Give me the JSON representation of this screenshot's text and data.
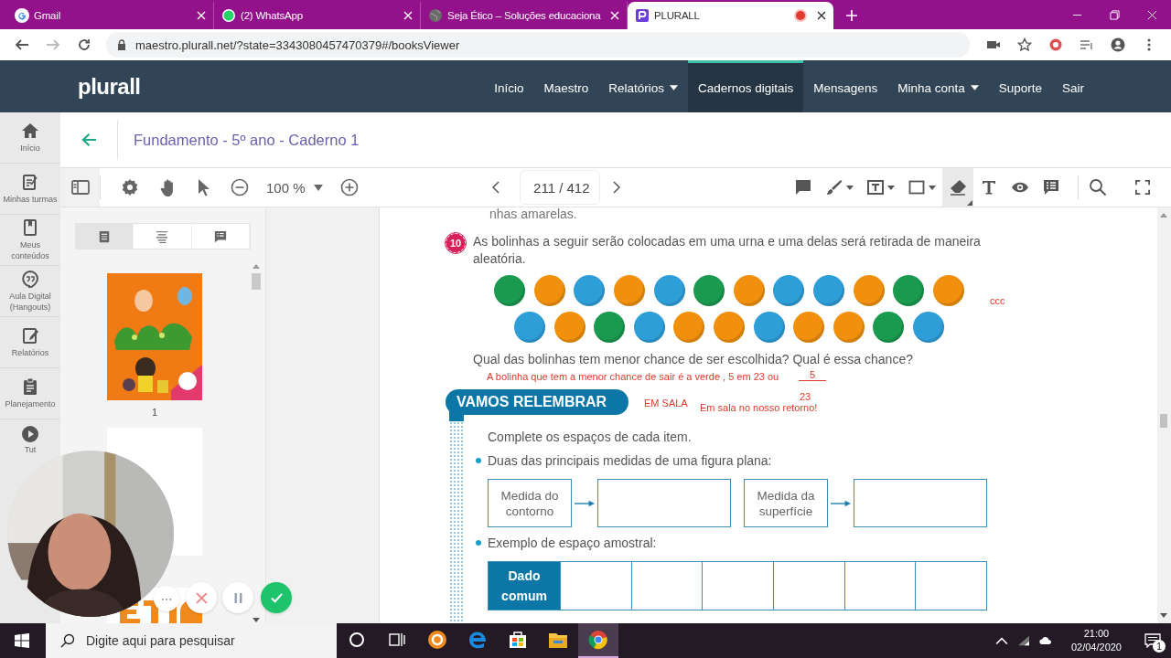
{
  "browser": {
    "tabs": [
      {
        "kind": "gmail",
        "title": "Gmail",
        "selected": false,
        "recording": false
      },
      {
        "kind": "whatsapp",
        "title": "(2) WhatsApp",
        "selected": false,
        "recording": false
      },
      {
        "kind": "web",
        "title": "Seja Ético – Soluções educaciona",
        "selected": false,
        "recording": false
      },
      {
        "kind": "plurall",
        "title": "PLURALL",
        "selected": true,
        "recording": true
      }
    ],
    "url": "maestro.plurall.net/?state=3343080457470379#/booksViewer"
  },
  "nav": {
    "logo": "plurall",
    "items": [
      {
        "label": "Início",
        "selected": false,
        "menu": false
      },
      {
        "label": "Maestro",
        "selected": false,
        "menu": false
      },
      {
        "label": "Relatórios",
        "selected": false,
        "menu": true
      },
      {
        "label": "Cadernos digitais",
        "selected": true,
        "menu": false
      },
      {
        "label": "Mensagens",
        "selected": false,
        "menu": false
      },
      {
        "label": "Minha conta",
        "selected": false,
        "menu": true
      },
      {
        "label": "Suporte",
        "selected": false,
        "menu": false
      },
      {
        "label": "Sair",
        "selected": false,
        "menu": false
      }
    ]
  },
  "rail": {
    "items": [
      {
        "kind": "home",
        "label": "Início"
      },
      {
        "kind": "edit",
        "label": "Minhas turmas"
      },
      {
        "kind": "book",
        "label": "Meus conteúdos"
      },
      {
        "kind": "chat",
        "label": "Aula Digital (Hangouts)"
      },
      {
        "kind": "report",
        "label": "Relatórios"
      },
      {
        "kind": "clipboard",
        "label": "Planejamento"
      },
      {
        "kind": "play",
        "label": "Tut"
      }
    ]
  },
  "header": {
    "title": "Fundamento - 5º ano - Caderno 1"
  },
  "toolbar": {
    "zoom": "100 %",
    "page": "211 / 412",
    "tools": [
      {
        "kind": "comment",
        "selected": false,
        "menu": false
      },
      {
        "kind": "pen",
        "selected": false,
        "menu": true
      },
      {
        "kind": "textbox",
        "selected": false,
        "menu": true
      },
      {
        "kind": "shape",
        "selected": false,
        "menu": true
      },
      {
        "kind": "eraser",
        "selected": true,
        "menu": false
      },
      {
        "kind": "text",
        "selected": false,
        "menu": false
      },
      {
        "kind": "eye",
        "selected": false,
        "menu": false
      },
      {
        "kind": "notes",
        "selected": false,
        "menu": false
      }
    ]
  },
  "sidebar": {
    "tabs": [
      {
        "kind": "thumbnails",
        "selected": true
      },
      {
        "kind": "outline",
        "selected": false
      },
      {
        "kind": "annotations",
        "selected": false
      }
    ],
    "page_label": "1"
  },
  "page": {
    "cut_line": "nhas amarelas.",
    "question": {
      "number": "10",
      "text": "As bolinhas a seguir serão colocadas em uma urna e uma delas será retirada de maneira aleatória.",
      "balls": [
        [
          {
            "color": "#1a9a4f"
          },
          {
            "color": "#f0900c"
          },
          {
            "color": "#2e9ed9"
          },
          {
            "color": "#f0900c"
          },
          {
            "color": "#2e9ed9"
          },
          {
            "color": "#1a9a4f"
          },
          {
            "color": "#f0900c"
          },
          {
            "color": "#2e9ed9"
          },
          {
            "color": "#2e9ed9"
          },
          {
            "color": "#f0900c"
          },
          {
            "color": "#1a9a4f"
          },
          {
            "color": "#f0900c"
          }
        ],
        [
          {
            "color": "#2e9ed9"
          },
          {
            "color": "#f0900c"
          },
          {
            "color": "#1a9a4f"
          },
          {
            "color": "#2e9ed9"
          },
          {
            "color": "#f0900c"
          },
          {
            "color": "#f0900c"
          },
          {
            "color": "#2e9ed9"
          },
          {
            "color": "#f0900c"
          },
          {
            "color": "#f0900c"
          },
          {
            "color": "#1a9a4f"
          },
          {
            "color": "#2e9ed9"
          }
        ]
      ],
      "prompt": "Qual das bolinhas tem menor chance de ser escolhida? Qual é essa chance?"
    },
    "annotations": {
      "side_note": "ccc",
      "answer": "A bolinha que tem a menor chance de sair é a verde , 5 em 23  ou",
      "numerator": "5",
      "denominator": "23",
      "tag": "EM SALA",
      "note": "Em sala no nosso retorno!"
    },
    "section": {
      "title": "VAMOS RELEMBRAR",
      "instruction": "Complete os espaços de cada item.",
      "bullet_1": "Duas das principais medidas de uma figura plana:",
      "measures": [
        {
          "label": "Medida do contorno"
        },
        {
          "label": "Medida da superfície"
        }
      ],
      "bullet_2": "Exemplo de espaço amostral:",
      "table_header": "Dado comum"
    }
  },
  "webcam": {
    "more": "⋯"
  },
  "taskbar": {
    "search_placeholder": "Digite aqui para pesquisar",
    "apps": [
      {
        "kind": "cortana",
        "selected": false
      },
      {
        "kind": "taskview",
        "selected": false
      },
      {
        "kind": "orange",
        "selected": false
      },
      {
        "kind": "edge",
        "selected": false
      },
      {
        "kind": "store",
        "selected": false
      },
      {
        "kind": "explorer",
        "selected": false
      },
      {
        "kind": "chrome",
        "selected": true
      }
    ],
    "time": "21:00",
    "date": "02/04/2020",
    "notifications": "1"
  }
}
